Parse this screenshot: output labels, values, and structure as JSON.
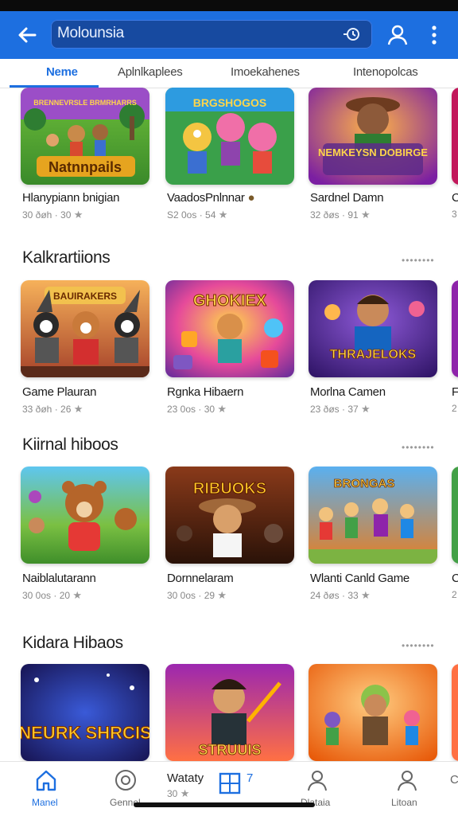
{
  "search": {
    "value": "Molounsia"
  },
  "tabs": [
    {
      "label": "Neme",
      "active": true
    },
    {
      "label": "Aplnlkaplees",
      "active": false
    },
    {
      "label": "Imoekahenes",
      "active": false
    },
    {
      "label": "Intenopolcas",
      "active": false
    }
  ],
  "row0": {
    "cards": [
      {
        "art_text": "Natnnpails",
        "art_banner": "BRENNEVRSLE BRMRHARRS",
        "title": "Hlanypiann bnigian",
        "meta": "30 ðøh · 30"
      },
      {
        "art_text": "",
        "art_banner": "BRGSHOGOS",
        "title": "VaadosPnlnnar",
        "meta": "S2 0os · 54"
      },
      {
        "art_text": "NEMKEYSN DOBIRGE",
        "art_banner": "",
        "title": "Sardnel Damn",
        "meta": "32 ðøs · 91"
      },
      {
        "art_text": "",
        "art_banner": "",
        "title": "C",
        "meta": "3"
      }
    ]
  },
  "sections": [
    {
      "title": "Kalkrartiions",
      "cards": [
        {
          "art_text": "",
          "art_banner": "BAUIRAKERS",
          "title": "Game Plauran",
          "meta": "33 ðøh · 26"
        },
        {
          "art_text": "",
          "art_banner": "GHOKIEX",
          "title": "Rgnka Hibaern",
          "meta": "23 0os · 30"
        },
        {
          "art_text": "THRAJELOKS",
          "art_banner": "",
          "title": "Morlna Camen",
          "meta": "23 ðøs · 37"
        },
        {
          "art_text": "",
          "art_banner": "",
          "title": "F",
          "meta": "2"
        }
      ]
    },
    {
      "title": "Kiirnal hiboos",
      "cards": [
        {
          "art_text": "",
          "art_banner": "",
          "title": "Naiblalutarann",
          "meta": "30 0os · 20"
        },
        {
          "art_text": "",
          "art_banner": "RIBUOKS",
          "title": "Dornnelaram",
          "meta": "30 0os · 29"
        },
        {
          "art_text": "",
          "art_banner": "BRONGAS",
          "title": "Wlanti Canld Game",
          "meta": "24 ðøs · 33"
        },
        {
          "art_text": "",
          "art_banner": "",
          "title": "C",
          "meta": "2"
        }
      ]
    },
    {
      "title": "Kidara Hibaos",
      "cards": [
        {
          "art_text": "NEURK SHRCIS",
          "art_banner": "",
          "title": "",
          "meta": ""
        },
        {
          "art_text": "STRUUIS",
          "art_banner": "",
          "title": "",
          "meta": ""
        },
        {
          "art_text": "",
          "art_banner": "",
          "title": "",
          "meta": ""
        },
        {
          "art_text": "",
          "art_banner": "",
          "title": "",
          "meta": ""
        }
      ]
    }
  ],
  "bottom_nav": [
    {
      "label": "Manel",
      "icon": "home-icon",
      "active": true
    },
    {
      "label": "Gennel",
      "icon": "games-icon",
      "active": false
    },
    {
      "label": "Wataty",
      "sublabel": "30",
      "icon": "apps-icon",
      "active": false,
      "badge": "7"
    },
    {
      "label": "Dlataia",
      "icon": "person-icon",
      "active": false
    },
    {
      "label": "Litoan",
      "icon": "account-icon",
      "active": false
    },
    {
      "label": "C",
      "icon": "more-icon",
      "active": false
    }
  ],
  "colors": {
    "accent": "#1d6fe0",
    "appbar": "#1d6fe0",
    "search_bg": "#174aa0"
  }
}
